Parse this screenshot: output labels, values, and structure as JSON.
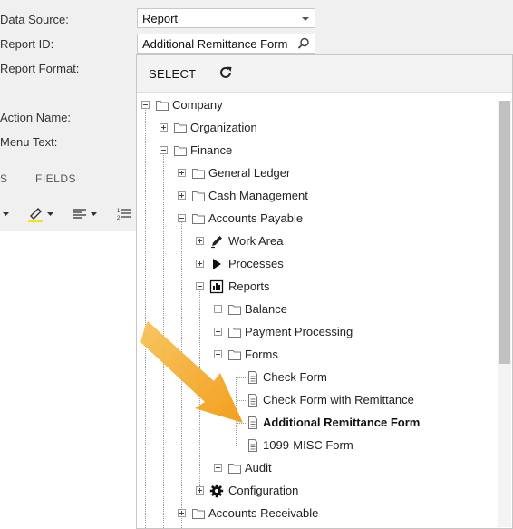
{
  "form": {
    "data_source_label": "Data Source:",
    "data_source_value": "Report",
    "report_id_label": "Report ID:",
    "report_id_value": "Additional Remittance Form",
    "report_format_label": "Report Format:",
    "action_name_label": "Action Name:",
    "menu_text_label": "Menu Text:"
  },
  "tabs": {
    "partial": "S",
    "fields": "FIELDS"
  },
  "popup": {
    "select_label": "SELECT",
    "refresh_icon": "refresh-icon"
  },
  "tree": {
    "company": "Company",
    "organization": "Organization",
    "finance": "Finance",
    "general_ledger": "General Ledger",
    "cash_management": "Cash Management",
    "accounts_payable": "Accounts Payable",
    "work_area": "Work Area",
    "processes": "Processes",
    "reports": "Reports",
    "balance": "Balance",
    "payment_processing": "Payment Processing",
    "forms": "Forms",
    "check_form": "Check Form",
    "check_form_remittance": "Check Form with Remittance",
    "additional_remittance_form": "Additional Remittance Form",
    "misc_1099_form": "1099-MISC Form",
    "audit": "Audit",
    "configuration": "Configuration",
    "accounts_receivable": "Accounts Receivable"
  },
  "colors": {
    "arrow": "#f5a623",
    "highlight_marker": "#f5e11a"
  }
}
